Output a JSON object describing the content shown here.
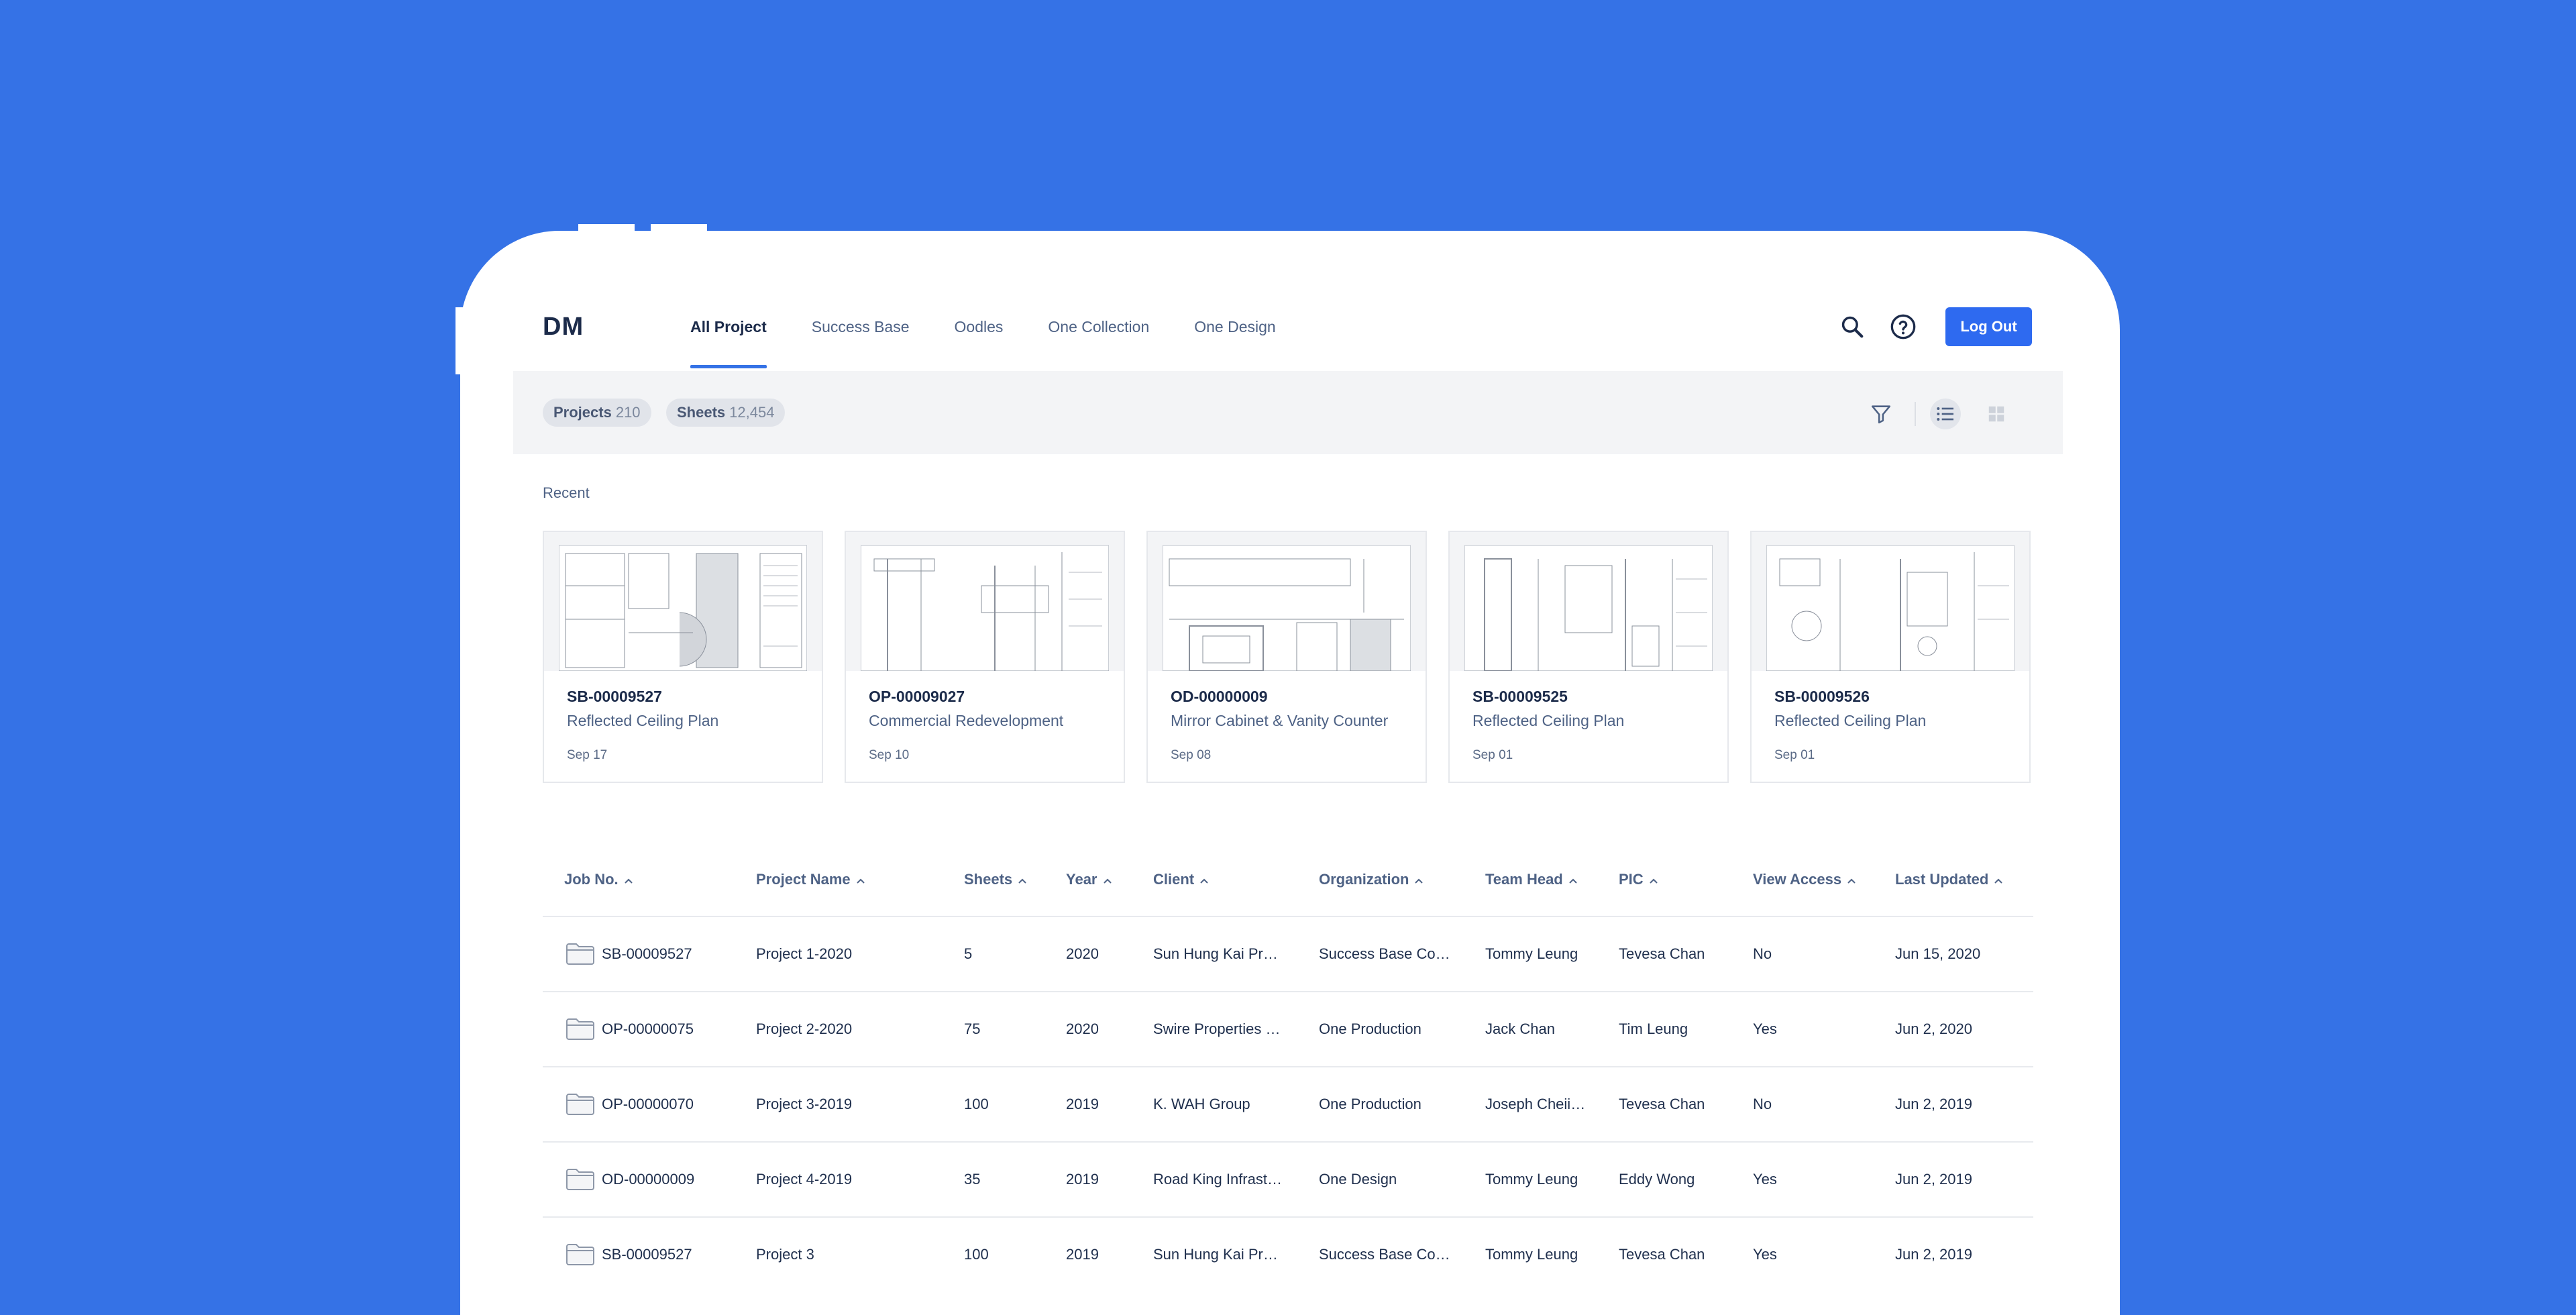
{
  "header": {
    "logo": "DM",
    "tabs": [
      {
        "label": "All Project",
        "active": true
      },
      {
        "label": "Success Base",
        "active": false
      },
      {
        "label": "Oodles",
        "active": false
      },
      {
        "label": "One Collection",
        "active": false
      },
      {
        "label": "One Design",
        "active": false
      }
    ],
    "search_icon": "search-icon",
    "help_icon": "help-circle-icon",
    "logout_label": "Log Out"
  },
  "toolbar": {
    "projects_label": "Projects",
    "projects_count": "210",
    "sheets_label": "Sheets",
    "sheets_count": "12,454",
    "filter_icon": "filter-icon",
    "list_view_icon": "list-view-icon",
    "grid_view_icon": "grid-view-icon",
    "active_view": "list"
  },
  "recent": {
    "label": "Recent",
    "cards": [
      {
        "job": "SB-00009527",
        "title": "Reflected Ceiling Plan",
        "date": "Sep 17"
      },
      {
        "job": "OP-00009027",
        "title": "Commercial Redevelopment",
        "date": "Sep 10"
      },
      {
        "job": "OD-00000009",
        "title": "Mirror Cabinet & Vanity Counter",
        "date": "Sep 08"
      },
      {
        "job": "SB-00009525",
        "title": "Reflected Ceiling Plan",
        "date": "Sep 01"
      },
      {
        "job": "SB-00009526",
        "title": "Reflected Ceiling Plan",
        "date": "Sep 01"
      }
    ]
  },
  "table": {
    "columns": [
      "Job No.",
      "Project Name",
      "Sheets",
      "Year",
      "Client",
      "Organization",
      "Team Head",
      "PIC",
      "View Access",
      "Last Updated"
    ],
    "rows": [
      [
        "SB-00009527",
        "Project 1-2020",
        "5",
        "2020",
        "Sun Hung Kai Pro…",
        "Success Base Co…",
        "Tommy Leung",
        "Tevesa Chan",
        "No",
        "Jun 15, 2020"
      ],
      [
        "OP-00000075",
        "Project 2-2020",
        "75",
        "2020",
        "Swire Properties …",
        "One Production",
        "Jack Chan",
        "Tim Leung",
        "Yes",
        "Jun 2, 2020"
      ],
      [
        "OP-00000070",
        "Project 3-2019",
        "100",
        "2019",
        "K. WAH Group",
        "One Production",
        "Joseph Cheii…",
        "Tevesa Chan",
        "No",
        "Jun 2, 2019"
      ],
      [
        "OD-00000009",
        "Project 4-2019",
        "35",
        "2019",
        "Road King Infrast…",
        "One Design",
        "Tommy Leung",
        "Eddy Wong",
        "Yes",
        "Jun 2, 2019"
      ],
      [
        "SB-00009527",
        "Project 3",
        "100",
        "2019",
        "Sun Hung Kai Pro…",
        "Success Base Co…",
        "Tommy Leung",
        "Tevesa Chan",
        "Yes",
        "Jun 2, 2019"
      ]
    ]
  },
  "colors": {
    "background": "#3572e6",
    "accent": "#2e6af0",
    "text_primary": "#1c2b4a",
    "text_secondary": "#4e6285"
  }
}
